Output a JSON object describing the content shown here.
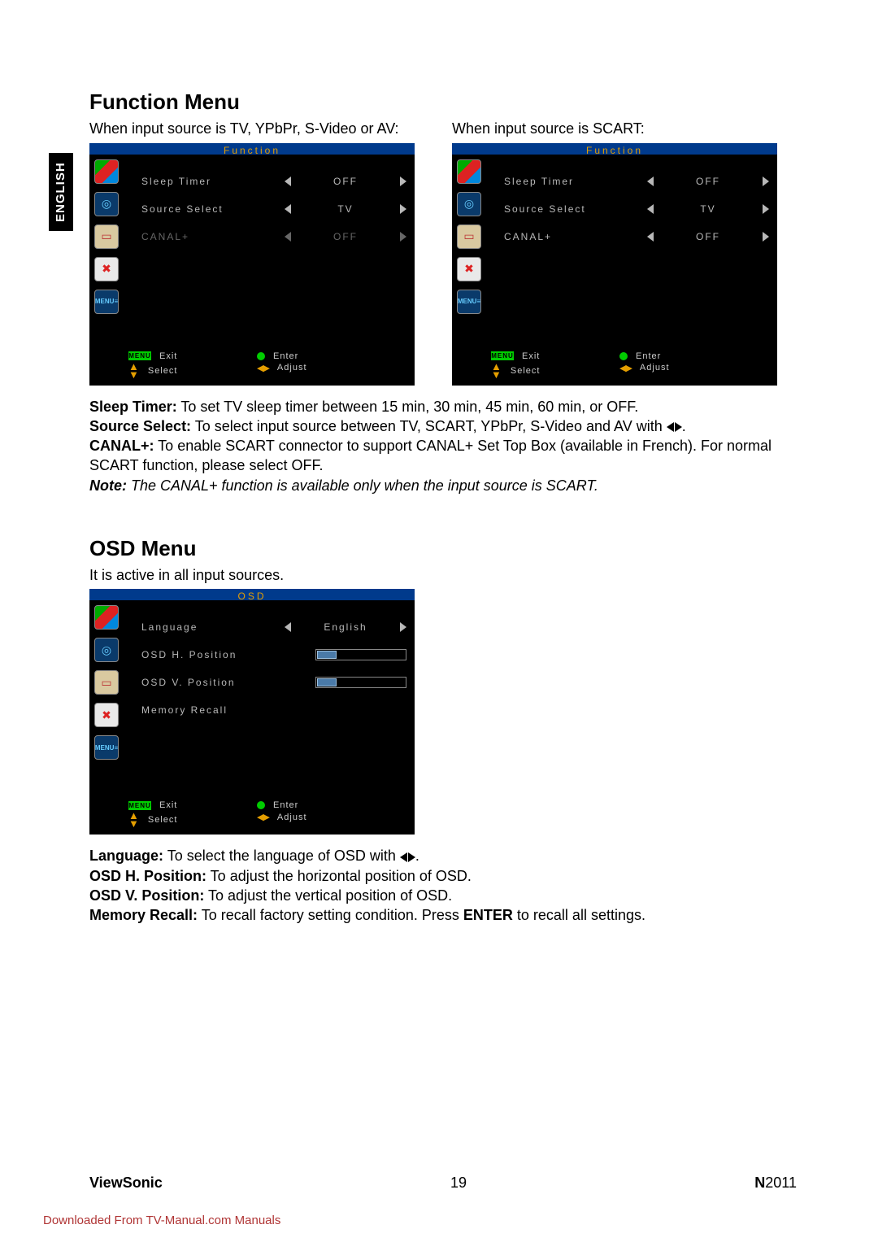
{
  "lang_tab": "ENGLISH",
  "section1": {
    "title": "Function Menu",
    "intro_left": "When input source is TV, YPbPr, S-Video or AV:",
    "intro_right": "When input source is SCART:"
  },
  "osd_function": {
    "title": "Function",
    "rows": [
      {
        "label": "Sleep Timer",
        "value": "OFF",
        "dim": false
      },
      {
        "label": "Source Select",
        "value": "TV",
        "dim": false
      },
      {
        "label": "CANAL+",
        "value": "OFF",
        "dim": true
      }
    ],
    "rows_scart": [
      {
        "label": "Sleep Timer",
        "value": "OFF",
        "dim": false
      },
      {
        "label": "Source Select",
        "value": "TV",
        "dim": false
      },
      {
        "label": "CANAL+",
        "value": "OFF",
        "dim": false
      }
    ],
    "footer": {
      "exit": "Exit",
      "select": "Select",
      "enter": "Enter",
      "adjust": "Adjust",
      "menu_btn": "MENU"
    }
  },
  "desc1": {
    "sleep_label": "Sleep Timer:",
    "sleep_text": " To set TV sleep timer between 15 min, 30 min, 45 min, 60 min, or OFF.",
    "source_label": "Source Select:",
    "source_text": " To select input source between TV, SCART, YPbPr, S-Video and AV with ",
    "canal_label": "CANAL+:",
    "canal_text": " To enable SCART connector to support CANAL+ Set Top Box (available in French). For normal SCART function, please select OFF.",
    "note_label": "Note:",
    "note_text": " The CANAL+ function is available only when the input source is SCART."
  },
  "section2": {
    "title": "OSD Menu",
    "intro": "It is active in all input sources."
  },
  "osd_osd": {
    "title": "OSD",
    "rows": [
      {
        "label": "Language",
        "type": "value",
        "value": "English"
      },
      {
        "label": "OSD H. Position",
        "type": "slider"
      },
      {
        "label": "OSD V. Position",
        "type": "slider"
      },
      {
        "label": "Memory Recall",
        "type": "none"
      }
    ],
    "footer": {
      "exit": "Exit",
      "select": "Select",
      "enter": "Enter",
      "adjust": "Adjust",
      "menu_btn": "MENU"
    }
  },
  "desc2": {
    "lang_label": "Language:",
    "lang_text": " To select the language of OSD with ",
    "h_label": "OSD H. Position:",
    "h_text": " To adjust the horizontal position of OSD.",
    "v_label": "OSD V. Position:",
    "v_text": " To adjust the vertical position of OSD.",
    "mr_label": "Memory Recall:",
    "mr_text1": " To recall factory setting condition. Press ",
    "mr_enter": "ENTER",
    "mr_text2": " to recall all settings."
  },
  "footer": {
    "brand": "ViewSonic",
    "page": "19",
    "model_bold": "N",
    "model_rest": "2011"
  },
  "download": "Downloaded From TV-Manual.com Manuals"
}
